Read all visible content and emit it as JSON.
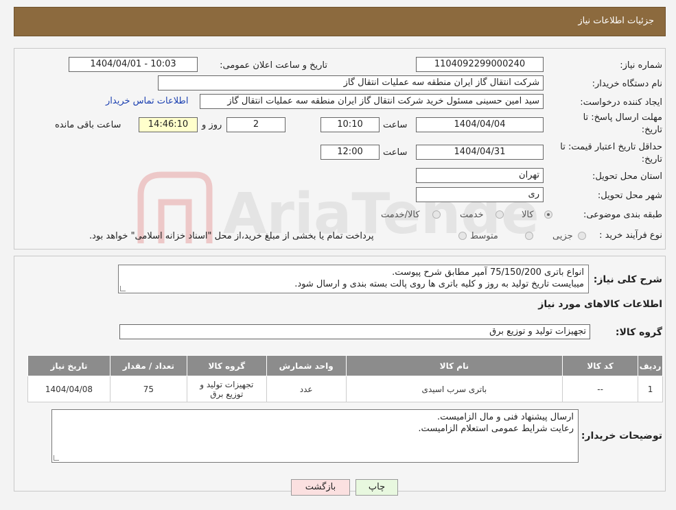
{
  "header": {
    "title": "جزئیات اطلاعات نیاز"
  },
  "form": {
    "need_number_label": "شماره نیاز:",
    "need_number": "1104092299000240",
    "announce_label": "تاریخ و ساعت اعلان عمومی:",
    "announce_value": "1404/04/01 - 10:03",
    "buyer_org_label": "نام دستگاه خریدار:",
    "buyer_org": "شرکت انتقال گاز ایران منطقه سه عملیات انتقال گاز",
    "creator_label": "ایجاد کننده درخواست:",
    "creator": "سید امین حسینی مسئول خرید شرکت انتقال گاز ایران منطقه سه عملیات انتقال گاز",
    "contact_link": "اطلاعات تماس خریدار",
    "deadline_label_1": "مهلت ارسال پاسخ: تا",
    "deadline_label_2": "تاریخ:",
    "deadline_date": "1404/04/04",
    "time_label": "ساعت",
    "deadline_time": "10:10",
    "days_value": "2",
    "days_label": "روز و",
    "remaining_time": "14:46:10",
    "remaining_label": "ساعت باقی مانده",
    "validity_label_1": "حداقل تاریخ اعتبار قیمت: تا",
    "validity_label_2": "تاریخ:",
    "validity_date": "1404/04/31",
    "validity_time": "12:00",
    "province_label": "استان محل تحویل:",
    "province": "تهران",
    "city_label": "شهر محل تحویل:",
    "city": "ری",
    "category_label": "طبقه بندی موضوعی:",
    "category_options": [
      "کالا",
      "خدمت",
      "کالا/خدمت"
    ],
    "purchase_type_label": "نوع فرآیند خرید :",
    "purchase_options": [
      "جزیی",
      "متوسط"
    ],
    "payment_note": "پرداخت تمام یا بخشی از مبلغ خرید،از محل \"اسناد خزانه اسلامی\" خواهد بود."
  },
  "description": {
    "label": "شرح کلی نیاز:",
    "line1": "انواع باتری 75/150/200 آمپر مطابق شرح پیوست.",
    "line2": "میبایست تاریخ تولید به روز و کلیه باتری ها روی پالت بسته بندی و ارسال شود."
  },
  "goods": {
    "section_title": "اطلاعات کالاهای مورد نیاز",
    "group_label": "گروه کالا:",
    "group_value": "تجهیزات تولید و توزیع برق",
    "columns": [
      "ردیف",
      "کد کالا",
      "نام کالا",
      "واحد شمارش",
      "گروه کالا",
      "تعداد / مقدار",
      "تاریخ نیاز"
    ],
    "rows": [
      {
        "row": "1",
        "code": "--",
        "name": "باتری سرب اسیدی",
        "unit": "عدد",
        "group_line1": "تجهیزات تولید و",
        "group_line2": "توزیع برق",
        "qty": "75",
        "date": "1404/04/08"
      }
    ]
  },
  "buyer_notes": {
    "label": "توضیحات خریدار:",
    "line1": "ارسال پیشنهاد فنی و مال الزامیست.",
    "line2": "رعایت شرایط عمومی استعلام الزامیست."
  },
  "buttons": {
    "print": "چاپ",
    "back": "بازگشت"
  },
  "watermark": {
    "text": "AriaTender.neT"
  }
}
